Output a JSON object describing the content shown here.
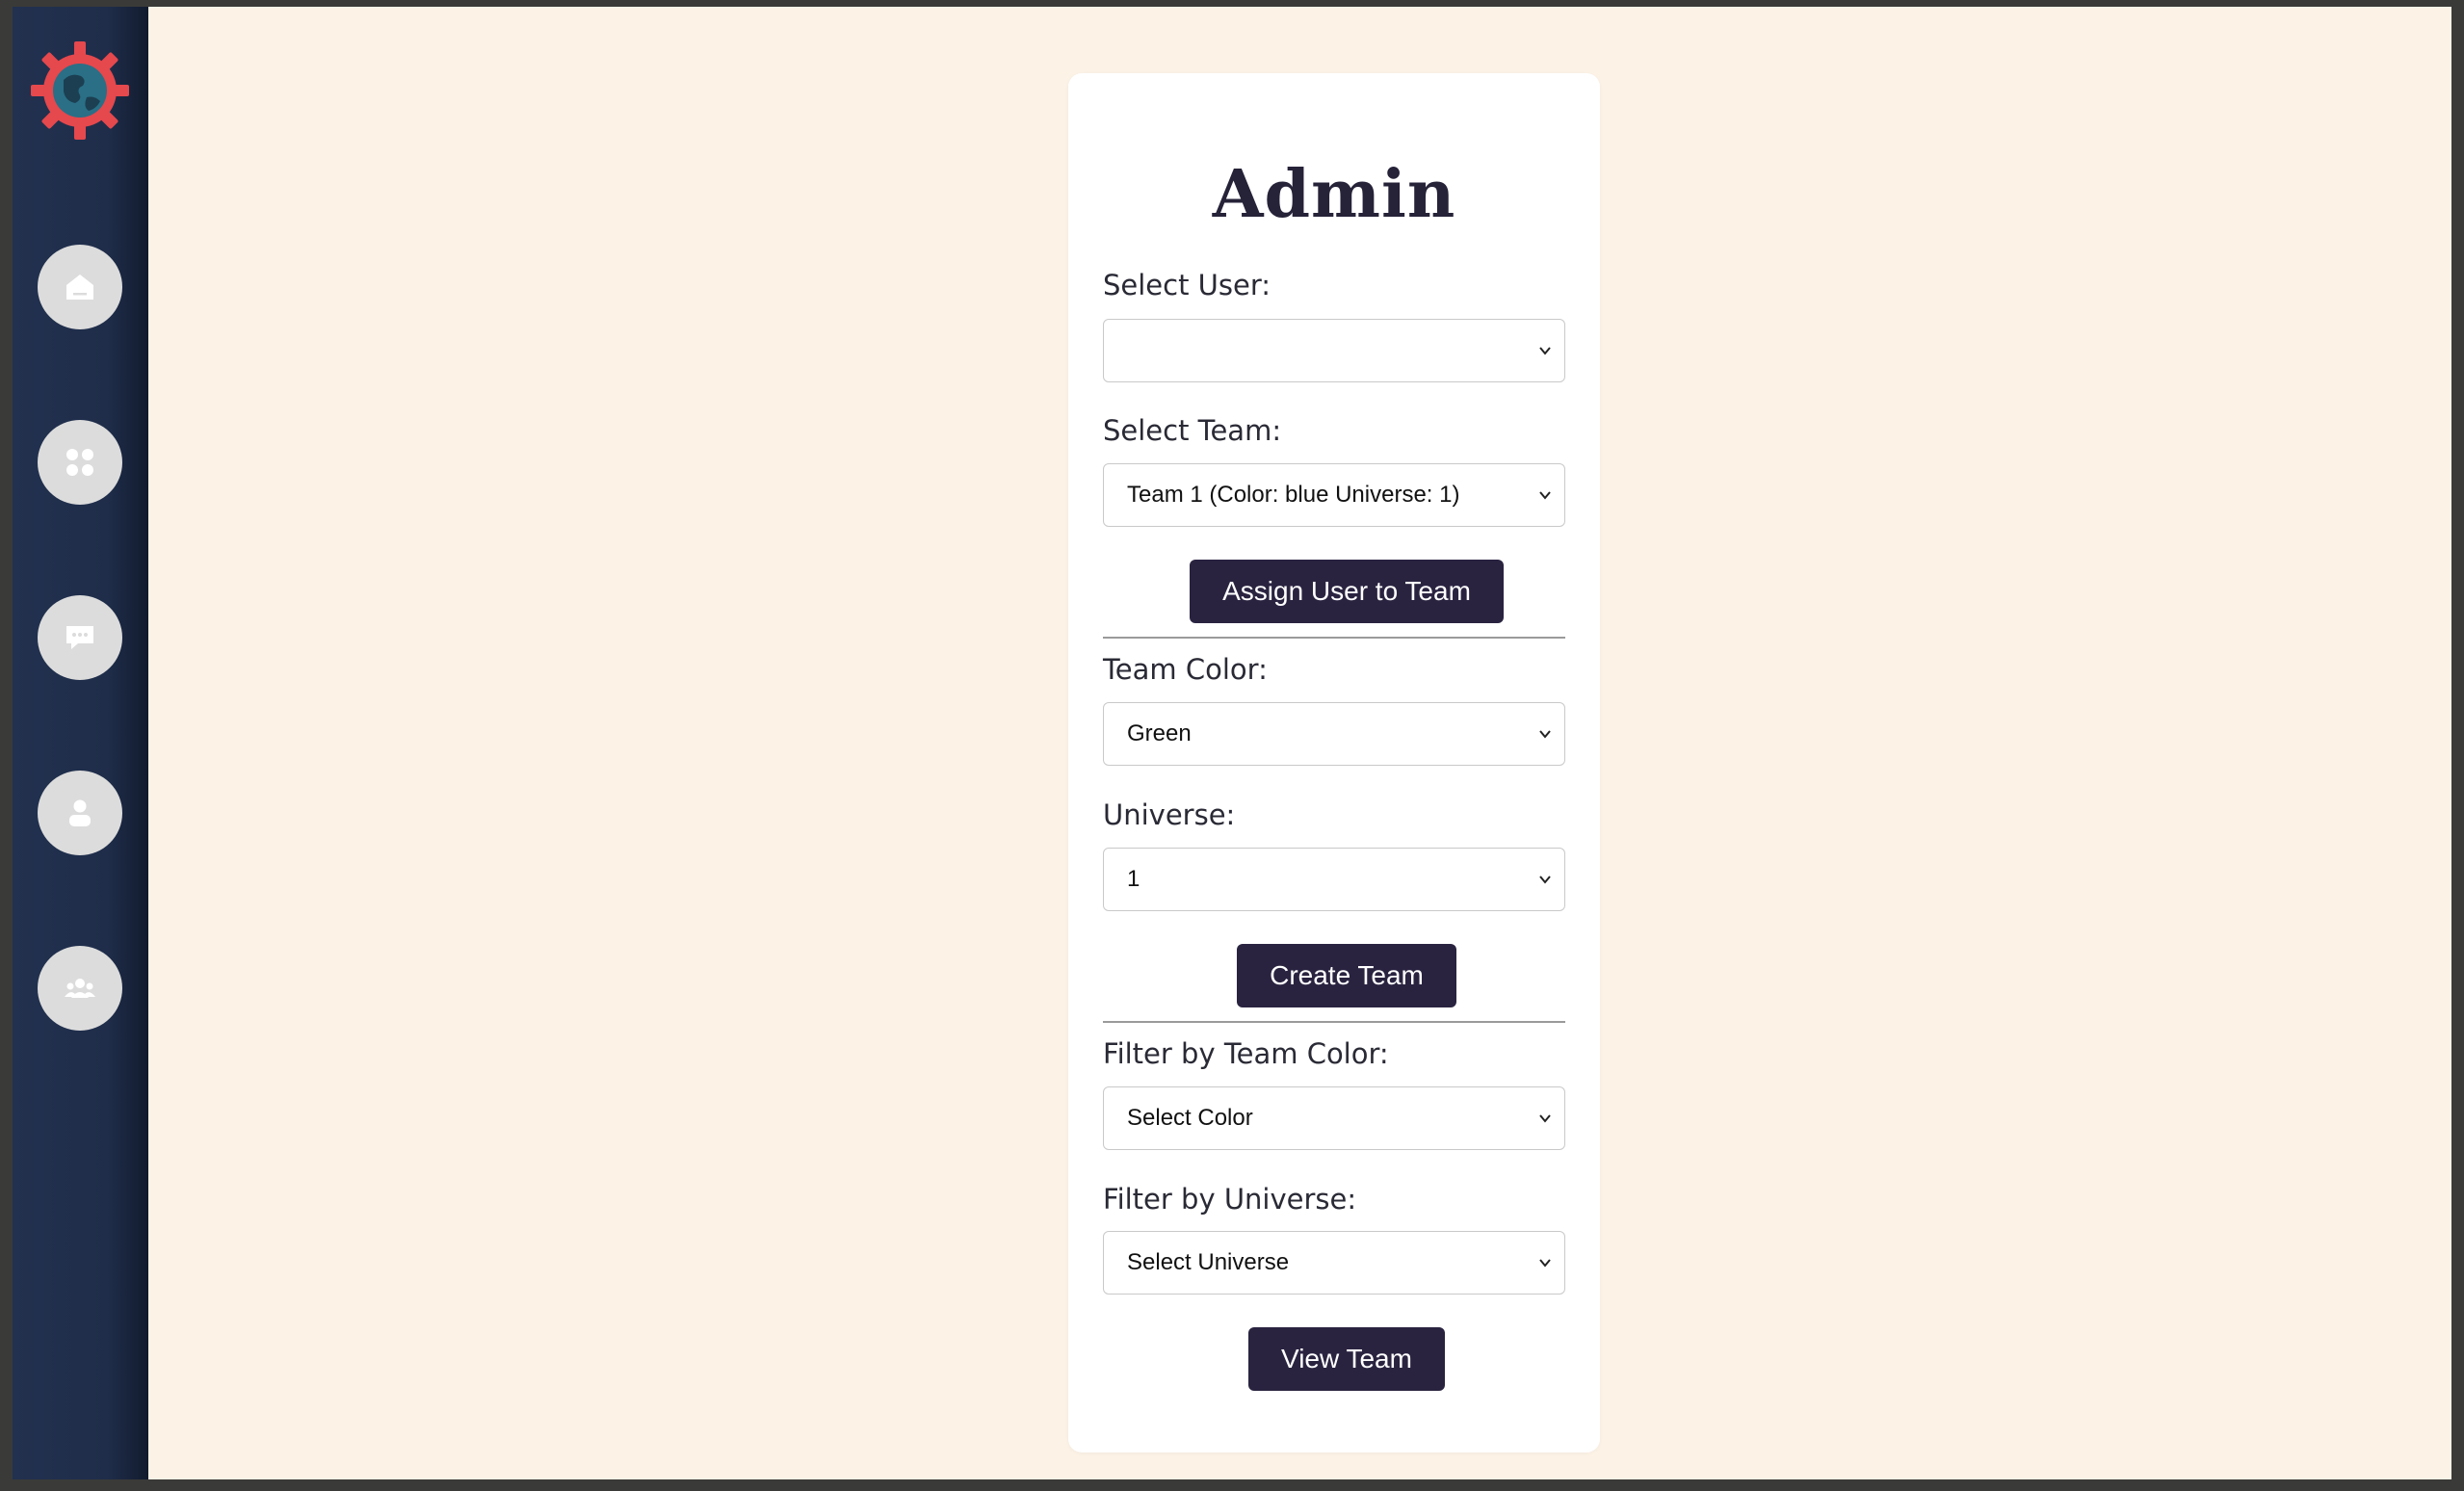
{
  "admin": {
    "title": "Admin",
    "select_user": {
      "label": "Select User:",
      "value": ""
    },
    "select_team": {
      "label": "Select Team:",
      "value": "Team 1 (Color: blue Universe: 1)"
    },
    "assign_button": "Assign User to Team",
    "team_color": {
      "label": "Team Color:",
      "value": "Green"
    },
    "universe": {
      "label": "Universe:",
      "value": "1"
    },
    "create_button": "Create Team",
    "filter_color": {
      "label": "Filter by Team Color:",
      "value": "Select Color"
    },
    "filter_universe": {
      "label": "Filter by Universe:",
      "value": "Select Universe"
    },
    "view_button": "View Team"
  },
  "sidebar": {
    "logo": "gear-globe-logo",
    "items": [
      {
        "icon": "home-icon"
      },
      {
        "icon": "apps-grid-icon"
      },
      {
        "icon": "chat-icon"
      },
      {
        "icon": "user-icon"
      },
      {
        "icon": "group-icon"
      }
    ]
  },
  "colors": {
    "sidebar": "#22314f",
    "background": "#fcf2e6",
    "button": "#2a2340",
    "logo_gear": "#e5484d",
    "logo_globe": "#2a6f86"
  }
}
